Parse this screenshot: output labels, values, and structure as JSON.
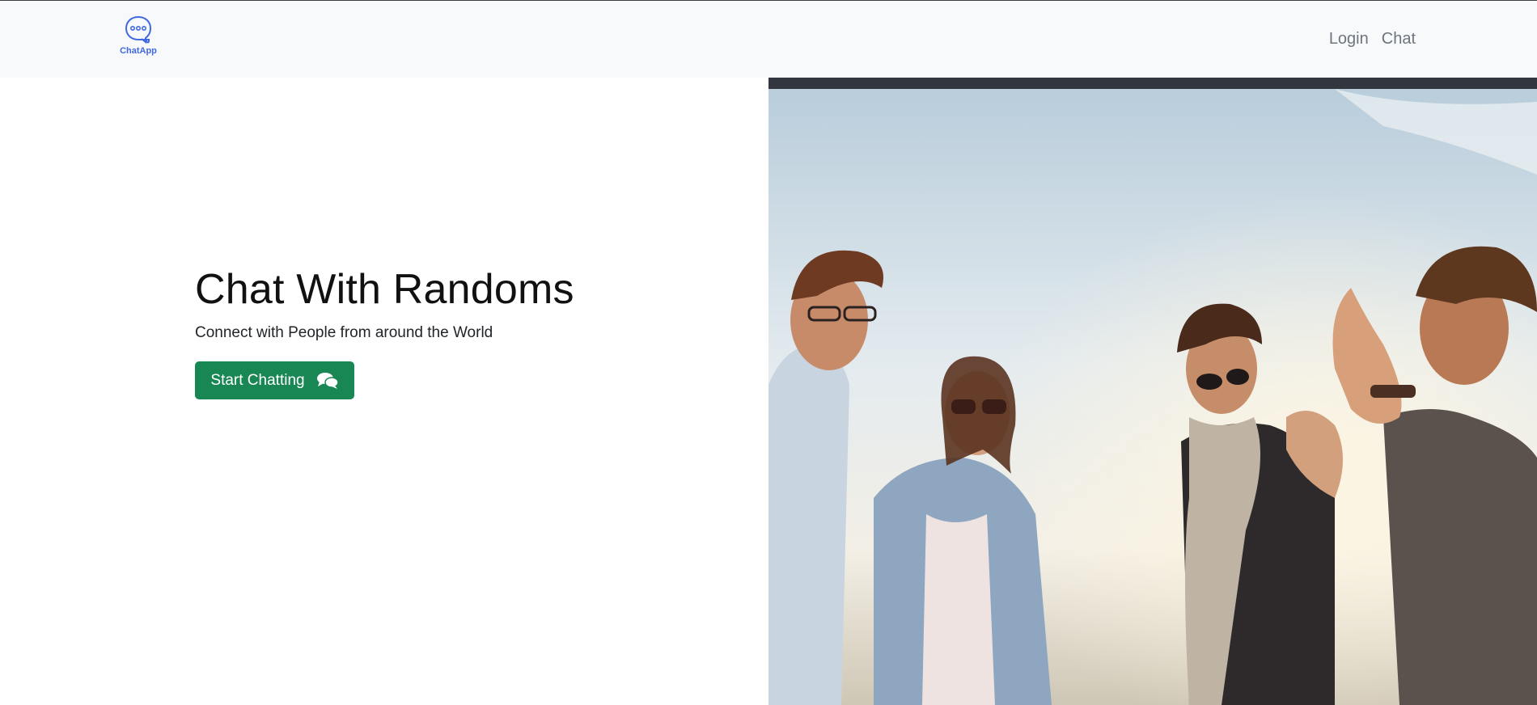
{
  "navbar": {
    "brand_label": "ChatApp",
    "brand_icon": "chat-bubble-icon",
    "links": [
      {
        "label": "Login"
      },
      {
        "label": "Chat"
      }
    ]
  },
  "hero": {
    "title": "Chat With Randoms",
    "subtitle": "Connect with People from around the World",
    "cta_label": "Start Chatting",
    "cta_icon": "comments-icon",
    "image_description_icon": "people-photo"
  },
  "colors": {
    "navbar_bg": "#f8f9fa",
    "brand": "#4169e1",
    "nav_link": "#6c757d",
    "cta_bg": "#198754",
    "cta_text": "#ffffff"
  }
}
